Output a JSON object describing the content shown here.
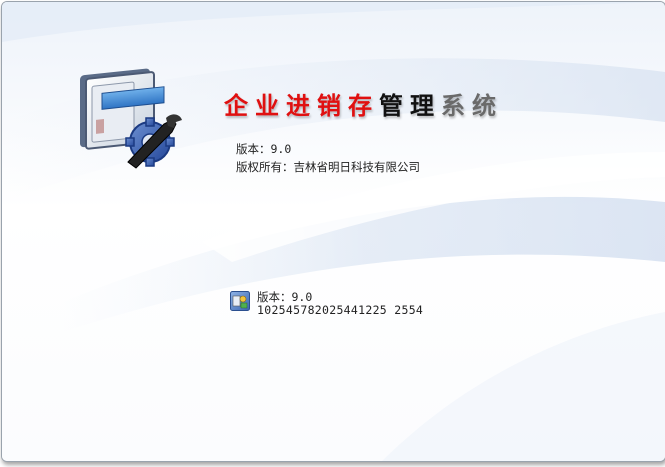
{
  "title": {
    "part1": "企业进销存",
    "part2": "管理",
    "part3": "系统"
  },
  "info": {
    "version_label": "版本：",
    "version_value": "9.0",
    "copyright_label": "版权所有：",
    "copyright_value": "吉林省明日科技有限公司"
  },
  "footer": {
    "version_label": "版本：",
    "version_value": "9.0",
    "serial": "102545782025441225 2554"
  },
  "icons": {
    "logo": "app-logo-icon",
    "footer": "product-key-icon"
  },
  "colors": {
    "title_red": "#e01010",
    "title_black": "#111111",
    "title_gray": "#6a6a6a",
    "swoosh_blue": "#c9d8ee"
  }
}
